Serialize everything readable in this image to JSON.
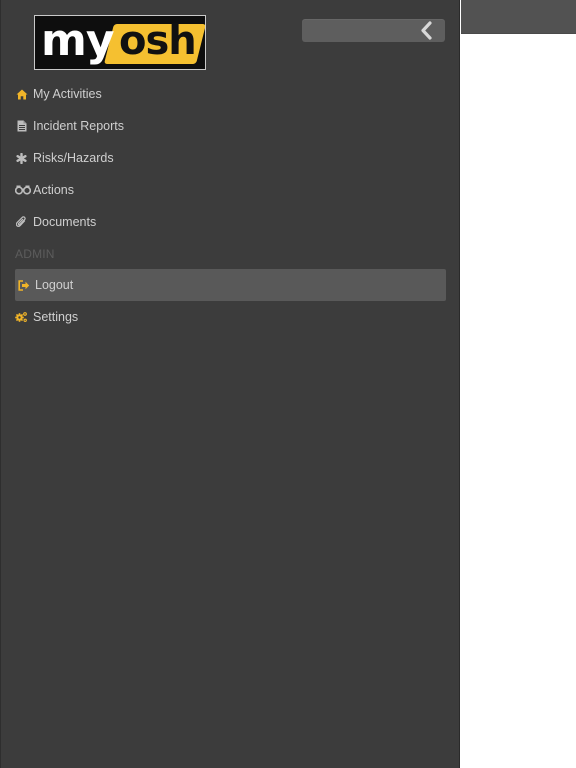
{
  "app": {
    "logo_text_my": "my",
    "logo_text_osh": "osh"
  },
  "header": {
    "collapse_icon": "chevron-left-icon"
  },
  "menu": {
    "items": [
      {
        "label": "My Activities",
        "icon": "home-icon",
        "icon_color": "#f0b429"
      },
      {
        "label": "Incident Reports",
        "icon": "document-icon",
        "icon_color": "#bdbdbd"
      },
      {
        "label": "Risks/Hazards",
        "icon": "asterisk-icon",
        "icon_color": "#bdbdbd"
      },
      {
        "label": "Actions",
        "icon": "binoculars-icon",
        "icon_color": "#bdbdbd"
      },
      {
        "label": "Documents",
        "icon": "paperclip-icon",
        "icon_color": "#bdbdbd"
      }
    ],
    "section_header": "ADMIN",
    "admin_items": [
      {
        "label": "Logout",
        "icon": "logout-icon",
        "icon_color": "#f0b429",
        "active": true
      },
      {
        "label": "Settings",
        "icon": "gears-icon",
        "icon_color": "#f0b429"
      }
    ]
  },
  "colors": {
    "drawer_bg": "#3c3c3c",
    "active_bg": "#595959",
    "accent": "#f0b429",
    "logo_yellow": "#f5c030"
  }
}
